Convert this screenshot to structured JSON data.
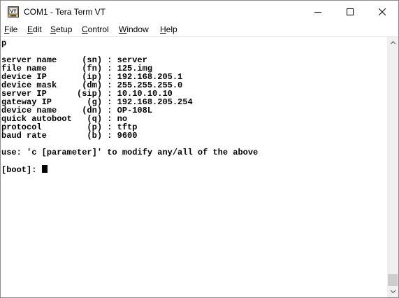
{
  "window": {
    "title": "COM1 - Tera Term VT",
    "icon_label": "VT",
    "buttons": [
      "minimize-icon",
      "maximize-icon",
      "close-icon"
    ]
  },
  "menu": {
    "items": [
      {
        "first": "F",
        "rest": "ile"
      },
      {
        "first": "E",
        "rest": "dit"
      },
      {
        "first": "S",
        "rest": "etup"
      },
      {
        "first": "C",
        "rest": "ontrol"
      },
      {
        "first": "W",
        "rest": "indow"
      },
      {
        "first": "H",
        "rest": "elp"
      }
    ]
  },
  "terminal": {
    "lines": [
      "p",
      "",
      "server name     (sn) : server",
      "file name       (fn) : 125.img",
      "device IP       (ip) : 192.168.205.1",
      "device mask     (dm) : 255.255.255.0",
      "server IP      (sip) : 10.10.10.10",
      "gateway IP       (g) : 192.168.205.254",
      "device name     (dn) : OP-108L",
      "quick autoboot   (q) : no",
      "protocol         (p) : tftp",
      "baud rate        (b) : 9600",
      "",
      "use: 'c [parameter]' to modify any/all of the above",
      "",
      "[boot]: "
    ]
  },
  "colors": {
    "background": "#ffffff",
    "text": "#000000",
    "scrollbar_track": "#f0f0f0",
    "scrollbar_thumb": "#cdcdcd"
  }
}
